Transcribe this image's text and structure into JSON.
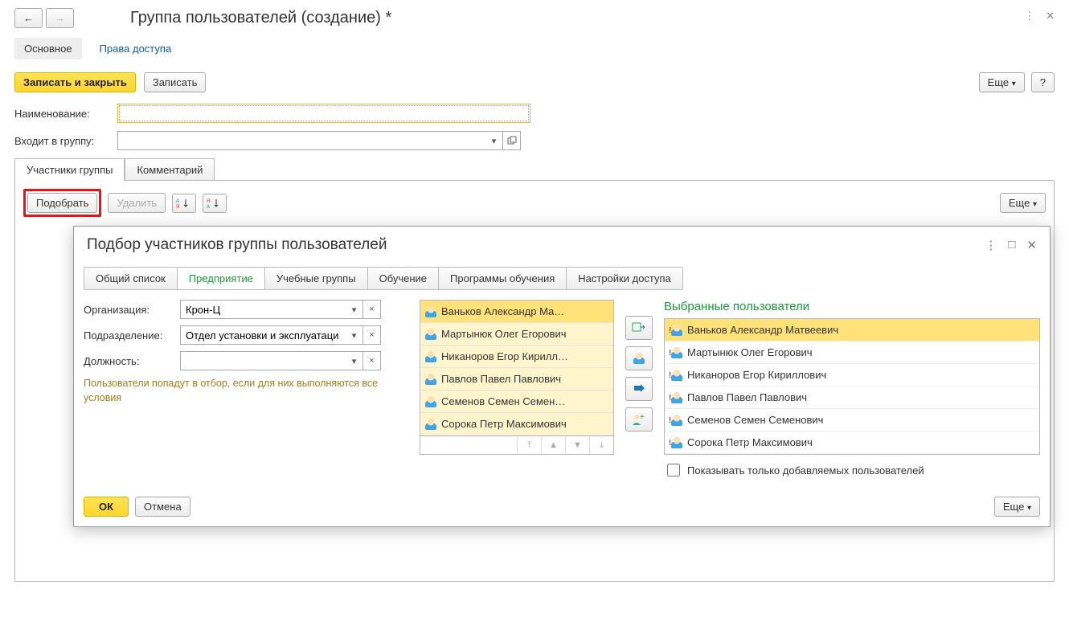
{
  "header": {
    "title": "Группа пользователей (создание) *"
  },
  "top_tabs": {
    "main": "Основное",
    "rights": "Права доступа"
  },
  "actions": {
    "save_close": "Записать и закрыть",
    "save": "Записать",
    "more": "Еще",
    "help": "?"
  },
  "form": {
    "name_label": "Наименование:",
    "name_value": "",
    "group_label": "Входит в группу:",
    "group_value": ""
  },
  "tabs": {
    "members": "Участники группы",
    "comment": "Комментарий"
  },
  "toolbar": {
    "pick": "Подобрать",
    "delete": "Удалить",
    "sort_asc_tip": "Сортировать по возрастанию",
    "sort_desc_tip": "Сортировать по убыванию",
    "more": "Еще"
  },
  "dialog": {
    "title": "Подбор участников группы пользователей",
    "tabs": [
      "Общий список",
      "Предприятие",
      "Учебные группы",
      "Обучение",
      "Программы обучения",
      "Настройки доступа"
    ],
    "active_tab": 1,
    "filters": {
      "org_label": "Организация:",
      "org_value": "Крон-Ц",
      "dept_label": "Подразделение:",
      "dept_value": "Отдел установки и эксплуатаци",
      "pos_label": "Должность:",
      "pos_value": "",
      "hint": "Пользователи попадут в отбор, если для них выполняются все условия"
    },
    "source_users": [
      "Ваньков Александр Ма…",
      "Мартынюк Олег Егорович",
      "Никаноров Егор Кирилл…",
      "Павлов Павел Павлович",
      "Семенов Семен Семен…",
      "Сорока Петр Максимович"
    ],
    "selected_title": "Выбранные пользователи",
    "selected_users": [
      "Ваньков Александр Матвеевич",
      "Мартынюк Олег Егорович",
      "Никаноров Егор Кириллович",
      "Павлов Павел Павлович",
      "Семенов Семен Семенович",
      "Сорока Петр Максимович"
    ],
    "show_only_added": "Показывать только добавляемых пользователей",
    "ok": "ОК",
    "cancel": "Отмена",
    "more": "Еще"
  }
}
